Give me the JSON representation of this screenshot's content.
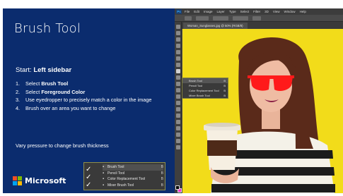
{
  "slide": {
    "title": "Brush Tool",
    "start_prefix": "Start: ",
    "start_location": "Left sidebar",
    "steps": [
      {
        "num": "1.",
        "prefix": "Select ",
        "bold": "Brush Tool",
        "suffix": ""
      },
      {
        "num": "2.",
        "prefix": "Select ",
        "bold": "Foreground Color",
        "suffix": ""
      },
      {
        "num": "3.",
        "prefix": "Use eyedropper to precisely match a color in the image",
        "bold": "",
        "suffix": ""
      },
      {
        "num": "4.",
        "prefix": "Brush over an area you want to change",
        "bold": "",
        "suffix": ""
      }
    ],
    "note": "Vary pressure to change brush thickness",
    "brand": "Microsoft"
  },
  "flyout": {
    "items": [
      {
        "label": "Brush Tool",
        "key": "B"
      },
      {
        "label": "Pencil Tool",
        "key": "B"
      },
      {
        "label": "Color Replacement Tool",
        "key": "B"
      },
      {
        "label": "Mixer Brush Tool",
        "key": "B"
      }
    ]
  },
  "photoshop": {
    "logo": "Ps",
    "menus": [
      "File",
      "Edit",
      "Image",
      "Layer",
      "Type",
      "Select",
      "Filter",
      "3D",
      "View",
      "Window",
      "Help"
    ],
    "doc_tab": "Woman_Sunglasses.jpg @ 50% (RGB/8)",
    "flyout_items": [
      {
        "label": "Brush Tool",
        "key": "B"
      },
      {
        "label": "Pencil Tool",
        "key": "B"
      },
      {
        "label": "Color Replacement Tool",
        "key": "B"
      },
      {
        "label": "Mixer Brush Tool",
        "key": "B"
      }
    ],
    "canvas_color": "#f2dc1a",
    "foreground_color": "#000000",
    "background_color": "#ff2bd6",
    "glasses_color": "#ff1a1a"
  }
}
